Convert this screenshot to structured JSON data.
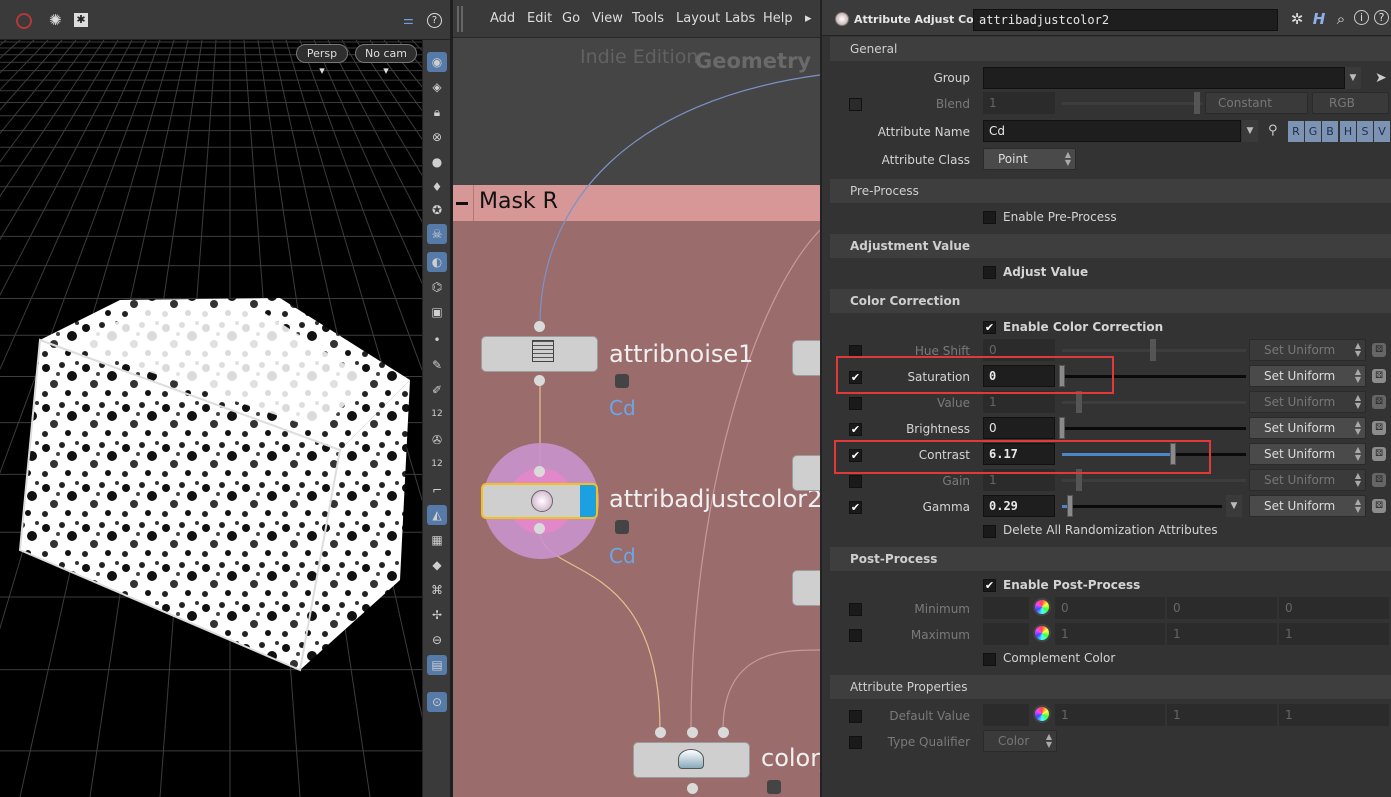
{
  "viewport": {
    "persp_label": "Persp ▾",
    "cam_label": "No cam ▾",
    "tool_numbers": [
      "12",
      "12"
    ]
  },
  "network": {
    "menu": [
      "Add",
      "Edit",
      "Go",
      "View",
      "Tools",
      "Layout",
      "Labs",
      "Help"
    ],
    "edition": "Indie Edition",
    "context": "Geometry",
    "netbox_title": "Mask R",
    "nodes": {
      "noise": {
        "name": "attribnoise1",
        "attr": "Cd"
      },
      "adjust": {
        "name": "attribadjustcolor2",
        "attr": "Cd"
      },
      "color": {
        "name": "color_"
      }
    }
  },
  "params": {
    "node_type": "Attribute Adjust Color",
    "node_name": "attribadjustcolor2",
    "general": {
      "title": "General",
      "group_label": "Group",
      "group_value": "",
      "blend_label": "Blend",
      "blend_value": "1",
      "blend_mode": "Constant",
      "blend_space": "RGB",
      "attr_name_label": "Attribute Name",
      "attr_name_value": "Cd",
      "channel_buttons": [
        "R",
        "G",
        "B",
        "H",
        "S",
        "V"
      ],
      "attr_class_label": "Attribute Class",
      "attr_class_value": "Point"
    },
    "preprocess": {
      "title": "Pre-Process",
      "enable_label": "Enable Pre-Process"
    },
    "adjust_value": {
      "title": "Adjustment Value",
      "enable_label": "Adjust Value"
    },
    "color_correction": {
      "title": "Color Correction",
      "enable_label": "Enable Color Correction",
      "set_uniform": "Set Uniform",
      "rows": [
        {
          "label": "Hue Shift",
          "value": "0"
        },
        {
          "label": "Saturation",
          "value": "0"
        },
        {
          "label": "Value",
          "value": "1"
        },
        {
          "label": "Brightness",
          "value": "0"
        },
        {
          "label": "Contrast",
          "value": "6.17"
        },
        {
          "label": "Gain",
          "value": "1"
        },
        {
          "label": "Gamma",
          "value": "0.29"
        }
      ],
      "delete_label": "Delete All Randomization Attributes"
    },
    "postprocess": {
      "title": "Post-Process",
      "enable_label": "Enable Post-Process",
      "min_label": "Minimum",
      "min_values": [
        "0",
        "0",
        "0"
      ],
      "max_label": "Maximum",
      "max_values": [
        "1",
        "1",
        "1"
      ],
      "complement_label": "Complement Color"
    },
    "attr_props": {
      "title": "Attribute Properties",
      "default_label": "Default Value",
      "default_values": [
        "1",
        "1",
        "1"
      ],
      "type_label": "Type Qualifier",
      "type_value": "Color"
    }
  },
  "colors": {
    "highlight": "#e0393a",
    "accent": "#567ba8",
    "netbox": "#9b6c6c"
  }
}
